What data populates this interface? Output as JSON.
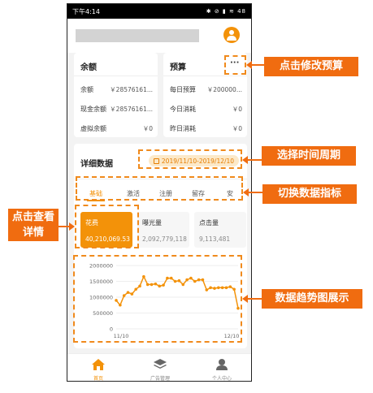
{
  "statusbar": {
    "time": "下午4:14",
    "icons": "✱ ⊘ ▮ ≋ 48"
  },
  "balance_card": {
    "title": "余额",
    "rows": [
      {
        "label": "余额",
        "value": "￥28576161..."
      },
      {
        "label": "现金余额",
        "value": "￥28576161..."
      },
      {
        "label": "虚拟余额",
        "value": "￥0"
      }
    ]
  },
  "budget_card": {
    "title": "预算",
    "more": "···",
    "rows": [
      {
        "label": "每日预算",
        "value": "￥200000..."
      },
      {
        "label": "今日消耗",
        "value": "￥0"
      },
      {
        "label": "昨日消耗",
        "value": "￥0"
      }
    ]
  },
  "detail": {
    "title": "详细数据",
    "date_range": "2019/11/10-2019/12/10",
    "tabs": [
      "基础",
      "激活",
      "注册",
      "留存",
      "安"
    ],
    "metrics": [
      {
        "label": "花费",
        "value": "40,210,069.53"
      },
      {
        "label": "曝光量",
        "value": "2,092,779,118"
      },
      {
        "label": "点击量",
        "value": "9,113,481"
      }
    ]
  },
  "chart_data": {
    "type": "line",
    "y_ticks": [
      "2000000",
      "1500000",
      "1000000",
      "500000",
      "0"
    ],
    "x_ticks": [
      "11/10",
      "12/10"
    ],
    "ylim": [
      0,
      2000000
    ],
    "series": [
      {
        "values": [
          900000,
          750000,
          1050000,
          1150000,
          1100000,
          1250000,
          1350000,
          1650000,
          1400000,
          1400000,
          1420000,
          1350000,
          1380000,
          1600000,
          1600000,
          1500000,
          1520000,
          1400000,
          1550000,
          1600000,
          1500000,
          1550000,
          1550000,
          1230000,
          1300000,
          1280000,
          1300000,
          1300000,
          1300000,
          1330000,
          1250000,
          650000
        ]
      }
    ],
    "color": "#f39209"
  },
  "navbar": {
    "items": [
      {
        "label": "首页",
        "icon": "home-icon"
      },
      {
        "label": "广告管理",
        "icon": "layers-icon"
      },
      {
        "label": "个人中心",
        "icon": "user-icon"
      }
    ]
  },
  "callouts": {
    "edit_budget": "点击修改预算",
    "select_period": "选择时间周期",
    "switch_metric": "切换数据指标",
    "view_detail": "点击查看详情",
    "trend_chart": "数据趋势图展示"
  },
  "colors": {
    "accent": "#f39209",
    "callout": "#f06c10"
  }
}
